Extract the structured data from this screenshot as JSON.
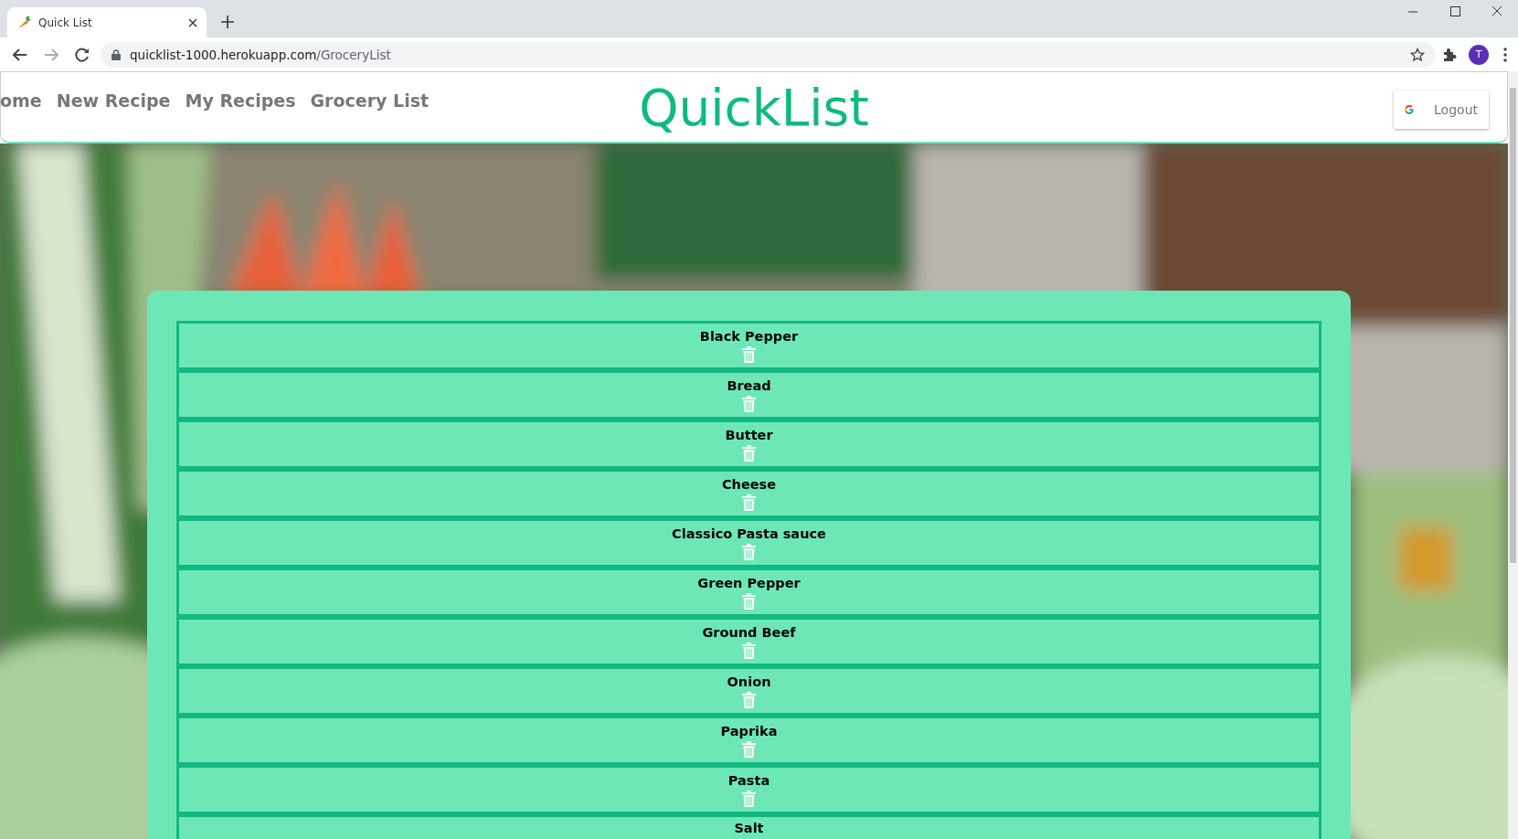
{
  "browser": {
    "tab_title": "Quick List",
    "url_host": "quicklist-1000.herokuapp.com",
    "url_path": "/GroceryList",
    "profile_initial": "T"
  },
  "nav": {
    "links": [
      {
        "label": "ome"
      },
      {
        "label": "New Recipe"
      },
      {
        "label": "My Recipes"
      },
      {
        "label": "Grocery List"
      }
    ],
    "logo": "QuickList",
    "logout": "Logout"
  },
  "grocery_list": {
    "items": [
      {
        "name": "Black Pepper"
      },
      {
        "name": "Bread"
      },
      {
        "name": "Butter"
      },
      {
        "name": "Cheese"
      },
      {
        "name": "Classico Pasta sauce"
      },
      {
        "name": "Green Pepper"
      },
      {
        "name": "Ground Beef"
      },
      {
        "name": "Onion"
      },
      {
        "name": "Paprika"
      },
      {
        "name": "Pasta"
      },
      {
        "name": "Salt",
        "kind": "cut"
      }
    ]
  }
}
